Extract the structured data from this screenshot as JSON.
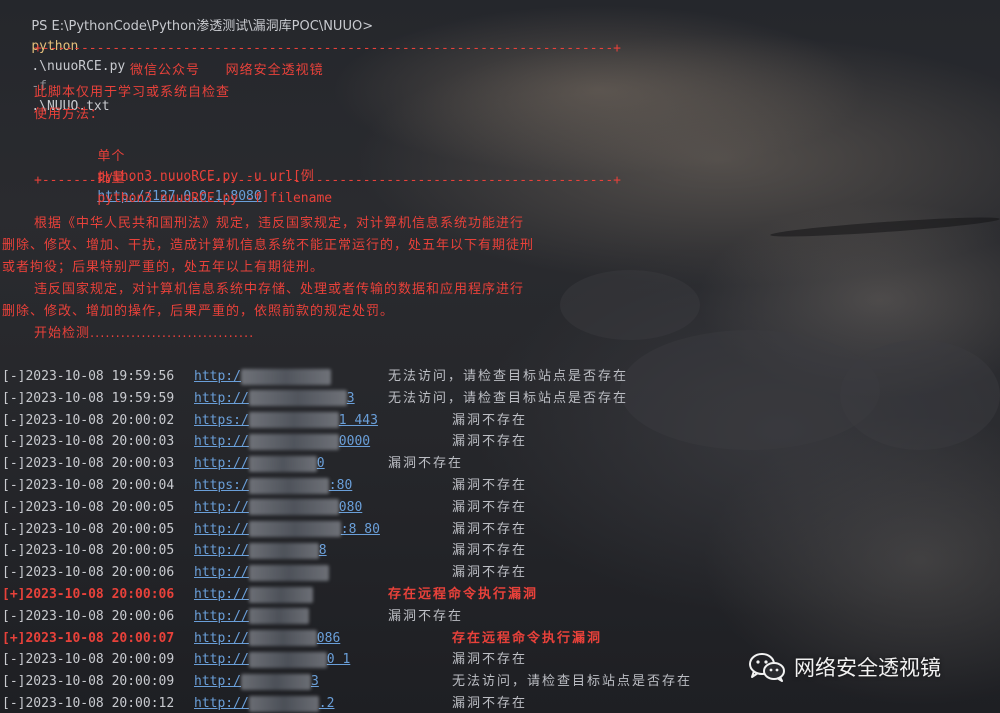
{
  "prompt": {
    "ps": "PS E:\\PythonCode\\Python渗透测试\\漏洞库POC\\NUUO>",
    "cmd": "python",
    "script": ".\\nuuoRCE.py",
    "flag": "-f",
    "file": ".\\NUUO.txt"
  },
  "banner": {
    "border": "+-------------------------------------------------------------------------+",
    "title": "微信公众号     网络安全透视镜",
    "line1": "此脚本仅用于学习或系统自检查",
    "line2": "使用方法：",
    "single_label": "单个",
    "single_cmd": "python3 nuuoRCE.py -u url[例",
    "single_url": "http://127.0.0.1:8080",
    "single_end": "]",
    "batch_label": "批量",
    "batch_cmd": "python3 nuuoRCE.py -f filename"
  },
  "legal": {
    "l1": "根据《中华人民共和国刑法》规定，违反国家规定，对计算机信息系统功能进行",
    "l2": "删除、修改、增加、干扰，造成计算机信息系统不能正常运行的，处五年以下有期徒刑",
    "l3": "或者拘役；后果特别严重的，处五年以上有期徒刑。",
    "l4": "违反国家规定，对计算机信息系统中存储、处理或者传输的数据和应用程序进行",
    "l5": "删除、修改、增加的操作，后果严重的，依照前款的规定处罚。",
    "l6": "开始检测................................"
  },
  "results": [
    {
      "time": "[-]2023-10-08 19:59:56",
      "url_start": "http:/",
      "url_end": "",
      "status": "无法访问，请检查目标站点是否存在",
      "hit": false
    },
    {
      "time": "[-]2023-10-08 19:59:59",
      "url_start": "http://",
      "url_end": "3",
      "status": "无法访问，请检查目标站点是否存在",
      "hit": false
    },
    {
      "time": "[-]2023-10-08 20:00:02",
      "url_start": "https:/",
      "url_end": "1 443",
      "status": "漏洞不存在",
      "hit": false
    },
    {
      "time": "[-]2023-10-08 20:00:03",
      "url_start": "http://",
      "url_end": "0000",
      "status": "漏洞不存在",
      "hit": false
    },
    {
      "time": "[-]2023-10-08 20:00:03",
      "url_start": "http://",
      "url_end": "0",
      "status": "漏洞不存在",
      "hit": false
    },
    {
      "time": "[-]2023-10-08 20:00:04",
      "url_start": "https:/",
      "url_end": ":80",
      "status": "漏洞不存在",
      "hit": false
    },
    {
      "time": "[-]2023-10-08 20:00:05",
      "url_start": "http://",
      "url_end": "080",
      "status": "漏洞不存在",
      "hit": false
    },
    {
      "time": "[-]2023-10-08 20:00:05",
      "url_start": "http://",
      "url_end": ":8 80",
      "status": "漏洞不存在",
      "hit": false
    },
    {
      "time": "[-]2023-10-08 20:00:05",
      "url_start": "http://",
      "url_end": "8",
      "status": "漏洞不存在",
      "hit": false
    },
    {
      "time": "[-]2023-10-08 20:00:06",
      "url_start": "http://",
      "url_end": "",
      "status": "漏洞不存在",
      "hit": false
    },
    {
      "time": "[+]2023-10-08 20:00:06",
      "url_start": "http://",
      "url_end": "",
      "status": "存在远程命令执行漏洞",
      "hit": true
    },
    {
      "time": "[-]2023-10-08 20:00:06",
      "url_start": "http://",
      "url_end": "",
      "status": "漏洞不存在",
      "hit": false
    },
    {
      "time": "[+]2023-10-08 20:00:07",
      "url_start": "http://",
      "url_end": "086",
      "status": "存在远程命令执行漏洞",
      "hit": true
    },
    {
      "time": "[-]2023-10-08 20:00:09",
      "url_start": "http://",
      "url_end": "0 1",
      "status": "漏洞不存在",
      "hit": false
    },
    {
      "time": "[-]2023-10-08 20:00:09",
      "url_start": "http:/",
      "url_end": "3",
      "status": "无法访问，请检查目标站点是否存在",
      "hit": false
    },
    {
      "time": "[-]2023-10-08 20:00:12",
      "url_start": "http://",
      "url_end": ".2",
      "status": "漏洞不存在",
      "hit": false
    }
  ],
  "watermark": {
    "text": "网络安全透视镜",
    "icon": "wechat-icon"
  },
  "colors": {
    "error_red": "#e8413a",
    "link_blue": "#6a9fd9",
    "command_yellow": "#e5c07b"
  }
}
